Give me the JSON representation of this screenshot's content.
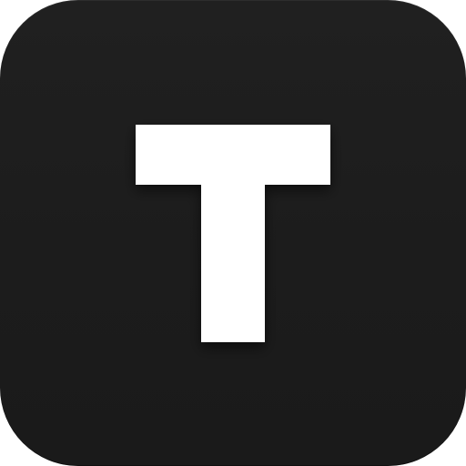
{
  "icon": {
    "name": "letter-t-app-icon",
    "letter": "T",
    "background_color": "#1c1c1c",
    "letter_color": "#ffffff"
  }
}
